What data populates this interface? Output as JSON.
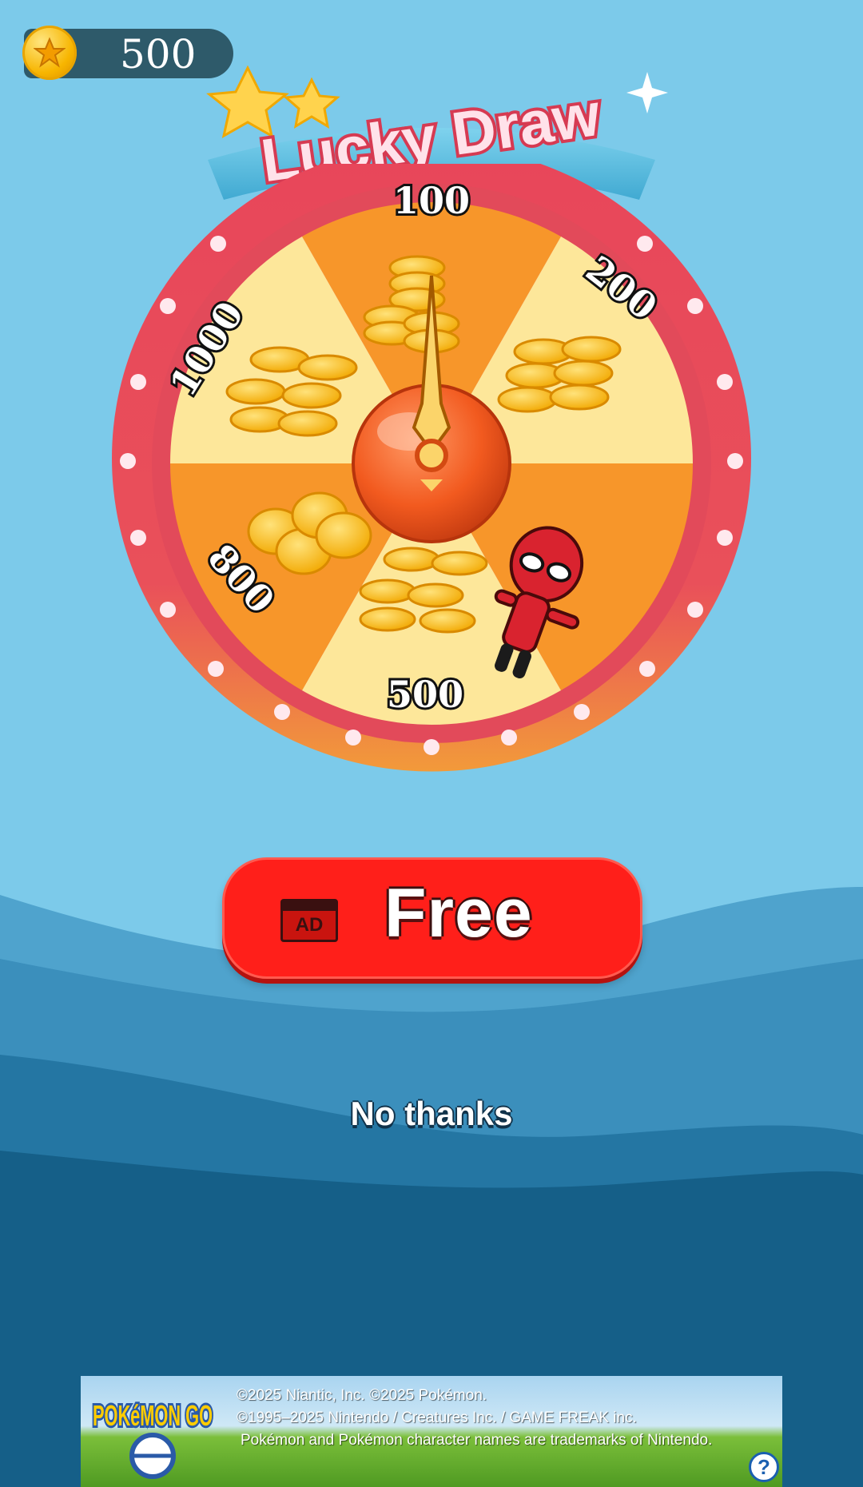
{
  "coins": {
    "value": "500"
  },
  "title": "Lucky Draw",
  "wheel": {
    "segments": [
      "100",
      "200",
      "500",
      "800",
      "1000"
    ]
  },
  "free_button": {
    "ad_label": "AD",
    "label": "Free"
  },
  "no_thanks": "No thanks",
  "ad_banner": {
    "line1": "©2025 Niantic, Inc. ©2025 Pokémon.",
    "line2": "©1995–2025 Nintendo / Creatures Inc. / GAME FREAK inc.",
    "line3": "Pokémon and Pokémon character names are trademarks of Nintendo.",
    "logo_text": "POKéMON GO",
    "help_icon": "?"
  }
}
